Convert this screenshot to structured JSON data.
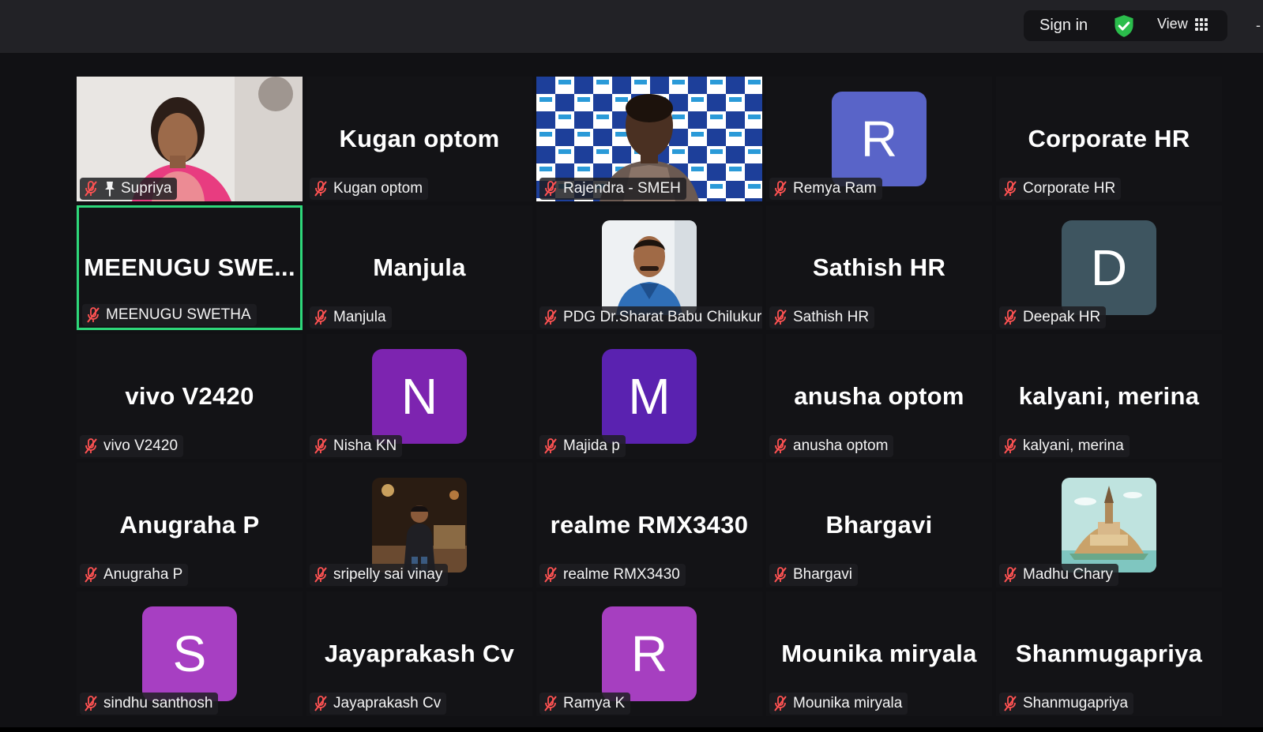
{
  "toolbar": {
    "sign_in_label": "Sign in",
    "shield_icon": "shield-check-icon",
    "view_label": "View",
    "view_icon": "grid-icon",
    "accent_shield": "#2bbd4c"
  },
  "active_speaker_color": "#2ed77a",
  "tiles": [
    {
      "id": "supriya",
      "name": "Supriya",
      "kind": "video",
      "pinned": true,
      "big_text": ""
    },
    {
      "id": "kugan-optom",
      "name": "Kugan optom",
      "kind": "name",
      "big_text": "Kugan optom"
    },
    {
      "id": "rajendra-smeh",
      "name": "Rajendra - SMEH",
      "kind": "video",
      "big_text": ""
    },
    {
      "id": "remya-ram",
      "name": "Remya Ram",
      "kind": "avatar",
      "initial": "R",
      "avatar_color": "#5964c8"
    },
    {
      "id": "corporate-hr",
      "name": "Corporate HR",
      "kind": "name",
      "big_text": "Corporate HR"
    },
    {
      "id": "meenugu-swetha",
      "name": "MEENUGU SWETHA",
      "kind": "name",
      "big_text": "MEENUGU  SWE...",
      "active": true
    },
    {
      "id": "manjula",
      "name": "Manjula",
      "kind": "name",
      "big_text": "Manjula"
    },
    {
      "id": "pdg-sharat",
      "name": "PDG Dr.Sharat Babu Chilukuri",
      "kind": "photo",
      "big_text": ""
    },
    {
      "id": "sathish-hr",
      "name": "Sathish HR",
      "kind": "name",
      "big_text": "Sathish HR"
    },
    {
      "id": "deepak-hr",
      "name": "Deepak HR",
      "kind": "avatar",
      "initial": "D",
      "avatar_color": "#3e5560"
    },
    {
      "id": "vivo-v2420",
      "name": "vivo V2420",
      "kind": "name",
      "big_text": "vivo V2420"
    },
    {
      "id": "nisha-kn",
      "name": "Nisha KN",
      "kind": "avatar",
      "initial": "N",
      "avatar_color": "#7d24b0"
    },
    {
      "id": "majida-p",
      "name": "Majida p",
      "kind": "avatar",
      "initial": "M",
      "avatar_color": "#5a22b0"
    },
    {
      "id": "anusha-optom",
      "name": "anusha optom",
      "kind": "name",
      "big_text": "anusha optom"
    },
    {
      "id": "kalyani-merina",
      "name": "kalyani, merina",
      "kind": "name",
      "big_text": "kalyani, merina"
    },
    {
      "id": "anugraha-p",
      "name": "Anugraha P",
      "kind": "name",
      "big_text": "Anugraha P"
    },
    {
      "id": "sripelly-sai-vinay",
      "name": "sripelly sai vinay",
      "kind": "photo",
      "big_text": ""
    },
    {
      "id": "realme-rmx3430",
      "name": "realme RMX3430",
      "kind": "name",
      "big_text": "realme RMX3430"
    },
    {
      "id": "bhargavi",
      "name": "Bhargavi",
      "kind": "name",
      "big_text": "Bhargavi"
    },
    {
      "id": "madhu-chary",
      "name": "Madhu Chary",
      "kind": "photo",
      "big_text": ""
    },
    {
      "id": "sindhu-santhosh",
      "name": "sindhu santhosh",
      "kind": "avatar",
      "initial": "S",
      "avatar_color": "#a73fc2"
    },
    {
      "id": "jayaprakash-cv",
      "name": "Jayaprakash Cv",
      "kind": "name",
      "big_text": "Jayaprakash Cv"
    },
    {
      "id": "ramya-k",
      "name": "Ramya K",
      "kind": "avatar",
      "initial": "R",
      "avatar_color": "#a63fc0"
    },
    {
      "id": "mounika-miryala",
      "name": "Mounika miryala",
      "kind": "name",
      "big_text": "Mounika miryala"
    },
    {
      "id": "shanmugapriya",
      "name": "Shanmugapriya",
      "kind": "name",
      "big_text": "Shanmugapriya"
    }
  ],
  "mic_state": "muted"
}
